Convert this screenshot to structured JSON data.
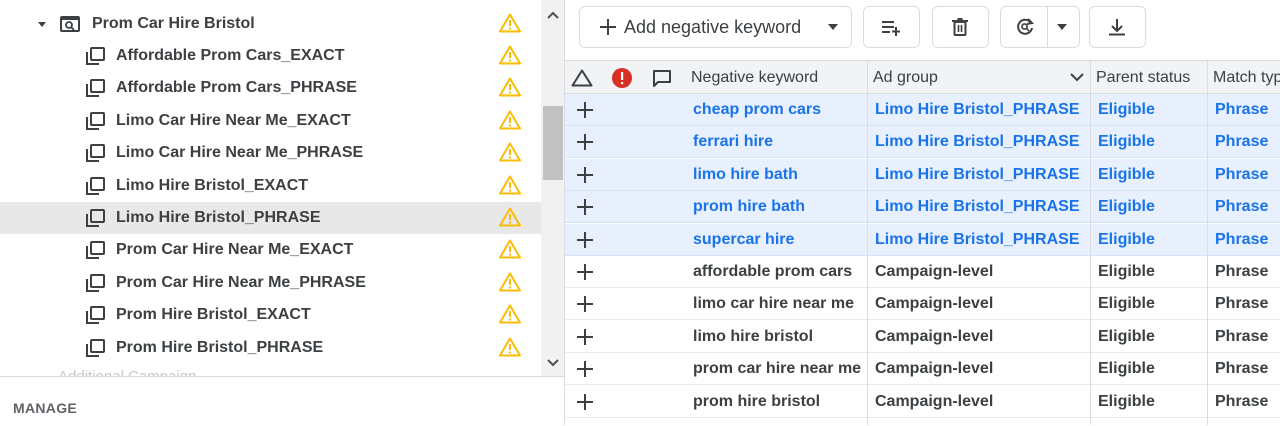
{
  "tree": {
    "campaign": {
      "label": "Prom Car Hire Bristol"
    },
    "ad_groups": [
      {
        "label": "Affordable Prom Cars_EXACT",
        "selected": false
      },
      {
        "label": "Affordable Prom Cars_PHRASE",
        "selected": false
      },
      {
        "label": "Limo Car Hire Near Me_EXACT",
        "selected": false
      },
      {
        "label": "Limo Car Hire Near Me_PHRASE",
        "selected": false
      },
      {
        "label": "Limo Hire Bristol_EXACT",
        "selected": false
      },
      {
        "label": "Limo Hire Bristol_PHRASE",
        "selected": true
      },
      {
        "label": "Prom Car Hire Near Me_EXACT",
        "selected": false
      },
      {
        "label": "Prom Car Hire Near Me_PHRASE",
        "selected": false
      },
      {
        "label": "Prom Hire Bristol_EXACT",
        "selected": false
      },
      {
        "label": "Prom Hire Bristol_PHRASE",
        "selected": false
      }
    ],
    "partial_next_item": "Additional Campaign",
    "warning_color": "#fbbc04"
  },
  "left_footer": {
    "manage_label": "MANAGE"
  },
  "toolbar": {
    "add_negative_keyword_label": "Add negative keyword"
  },
  "table": {
    "columns": {
      "negative_keyword": "Negative keyword",
      "ad_group": "Ad group",
      "parent_status": "Parent status",
      "match_type": "Match typ"
    },
    "rows": [
      {
        "keyword": "cheap prom cars",
        "ad_group": "Limo Hire Bristol_PHRASE",
        "parent_status": "Eligible",
        "match_type": "Phrase",
        "highlight": true
      },
      {
        "keyword": "ferrari hire",
        "ad_group": "Limo Hire Bristol_PHRASE",
        "parent_status": "Eligible",
        "match_type": "Phrase",
        "highlight": true
      },
      {
        "keyword": "limo hire bath",
        "ad_group": "Limo Hire Bristol_PHRASE",
        "parent_status": "Eligible",
        "match_type": "Phrase",
        "highlight": true
      },
      {
        "keyword": "prom hire bath",
        "ad_group": "Limo Hire Bristol_PHRASE",
        "parent_status": "Eligible",
        "match_type": "Phrase",
        "highlight": true
      },
      {
        "keyword": "supercar hire",
        "ad_group": "Limo Hire Bristol_PHRASE",
        "parent_status": "Eligible",
        "match_type": "Phrase",
        "highlight": true
      },
      {
        "keyword": "affordable prom cars",
        "ad_group": "Campaign-level",
        "parent_status": "Eligible",
        "match_type": "Phrase",
        "highlight": false
      },
      {
        "keyword": "limo car hire near me",
        "ad_group": "Campaign-level",
        "parent_status": "Eligible",
        "match_type": "Phrase",
        "highlight": false
      },
      {
        "keyword": "limo hire bristol",
        "ad_group": "Campaign-level",
        "parent_status": "Eligible",
        "match_type": "Phrase",
        "highlight": false
      },
      {
        "keyword": "prom car hire near me",
        "ad_group": "Campaign-level",
        "parent_status": "Eligible",
        "match_type": "Phrase",
        "highlight": false
      },
      {
        "keyword": "prom hire bristol",
        "ad_group": "Campaign-level",
        "parent_status": "Eligible",
        "match_type": "Phrase",
        "highlight": false
      }
    ]
  },
  "colors": {
    "link_blue": "#1a73e8",
    "highlight_row": "#e8f0fe",
    "error_red": "#d93025"
  }
}
